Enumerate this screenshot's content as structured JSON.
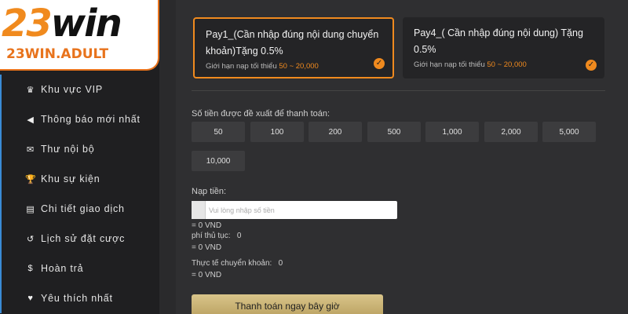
{
  "logo": {
    "main_num": "23",
    "main_txt": "win",
    "sub": "23WIN.ADULT"
  },
  "menu": [
    {
      "icon": "crown-icon",
      "glyph": "♛",
      "label": "Khu vực VIP"
    },
    {
      "icon": "megaphone-icon",
      "glyph": "◀",
      "label": "Thông báo mới nhất"
    },
    {
      "icon": "envelope-icon",
      "glyph": "✉",
      "label": "Thư nội bộ"
    },
    {
      "icon": "trophy-icon",
      "glyph": "🏆",
      "label": "Khu sự kiện"
    },
    {
      "icon": "clipboard-icon",
      "glyph": "▤",
      "label": "Chi tiết giao dịch"
    },
    {
      "icon": "history-icon",
      "glyph": "↺",
      "label": "Lịch sử đặt cược"
    },
    {
      "icon": "dollar-icon",
      "glyph": "$",
      "label": "Hoàn trả"
    },
    {
      "icon": "heart-icon",
      "glyph": "♥",
      "label": "Yêu thích nhất"
    }
  ],
  "payments": [
    {
      "title": "Pay1_(Cần nhập đúng nội dung chuyển khoản)Tặng 0.5%",
      "limit_prefix": "Giới hạn nạp tối thiểu ",
      "limit_range": "50 ~ 20,000",
      "selected": true
    },
    {
      "title": "Pay4_( Cần nhập đúng nội dung) Tặng 0.5%",
      "limit_prefix": "Giới hạn nạp tối thiểu ",
      "limit_range": "50 ~ 20,000",
      "selected": true
    }
  ],
  "suggest_label": "Số tiền được đề xuất để thanh toán:",
  "amounts": [
    "50",
    "100",
    "200",
    "500",
    "1,000",
    "2,000",
    "5,000",
    "10,000"
  ],
  "deposit": {
    "label": "Nạp tiền:",
    "placeholder": "Vui lòng nhập số tiền",
    "equals_vnd": "= 0 VND",
    "fee_label": "phí thủ tục:",
    "fee_value": "0",
    "fee_vnd": "= 0 VND",
    "actual_label": "Thực tế chuyển khoản:",
    "actual_value": "0",
    "actual_vnd": "= 0 VND"
  },
  "submit_label": "Thanh toán ngay bây giờ",
  "colors": {
    "accent": "#f08a1e",
    "sidebar_bg": "#1f1f21",
    "panel_bg": "#2f2f31",
    "button_gold": "#c9b274"
  }
}
